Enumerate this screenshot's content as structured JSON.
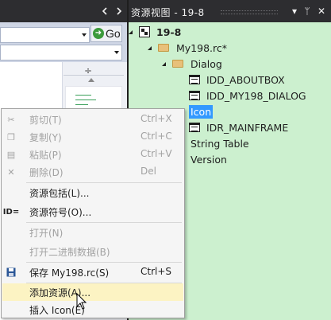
{
  "editor": {
    "go_label": "Go"
  },
  "resource_view": {
    "title": "资源视图 - 19-8",
    "tree": [
      {
        "label": "19-8",
        "level": 0,
        "kind": "root"
      },
      {
        "label": "My198.rc*",
        "level": 1,
        "kind": "folder"
      },
      {
        "label": "Dialog",
        "level": 2,
        "kind": "folder"
      },
      {
        "label": "IDD_ABOUTBOX",
        "level": 3,
        "kind": "dialog"
      },
      {
        "label": "IDD_MY198_DIALOG",
        "level": 3,
        "kind": "dialog"
      },
      {
        "label": "Icon",
        "level": 2,
        "kind": "selected"
      },
      {
        "label": "IDR_MAINFRAME",
        "level": 3,
        "kind": "dialog"
      },
      {
        "label": "String Table",
        "level": 2,
        "kind": "plain"
      },
      {
        "label": "Version",
        "level": 2,
        "kind": "plain"
      }
    ]
  },
  "context_menu": {
    "items": [
      {
        "label": "剪切(T)",
        "shortcut": "Ctrl+X",
        "icon": "scissors-icon",
        "disabled": true
      },
      {
        "label": "复制(Y)",
        "shortcut": "Ctrl+C",
        "icon": "copy-icon",
        "disabled": true
      },
      {
        "label": "粘贴(P)",
        "shortcut": "Ctrl+V",
        "icon": "paste-icon",
        "disabled": true
      },
      {
        "label": "删除(D)",
        "shortcut": "Del",
        "icon": "delete-icon",
        "disabled": true
      },
      {
        "label": "资源包括(L)...",
        "shortcut": "",
        "icon": "",
        "disabled": false
      },
      {
        "label": "资源符号(O)...",
        "shortcut": "",
        "icon": "resource-symbols-icon",
        "icon_text": "ID=",
        "disabled": false
      },
      {
        "label": "打开(N)",
        "shortcut": "",
        "icon": "",
        "disabled": true
      },
      {
        "label": "打开二进制数据(B)",
        "shortcut": "",
        "icon": "",
        "disabled": true
      },
      {
        "label": "保存 My198.rc(S)",
        "shortcut": "Ctrl+S",
        "icon": "save-icon",
        "disabled": false
      },
      {
        "label": "添加资源(A)...",
        "shortcut": "",
        "icon": "",
        "disabled": false,
        "highlighted": true
      },
      {
        "label": "插入 Icon(E)",
        "shortcut": "",
        "icon": "",
        "disabled": false
      }
    ]
  },
  "colors": {
    "pane_background": "#ccf0cf",
    "selection": "#3399ff",
    "menu_highlight": "#fcf3c3",
    "titlebar": "#2d2d30"
  }
}
